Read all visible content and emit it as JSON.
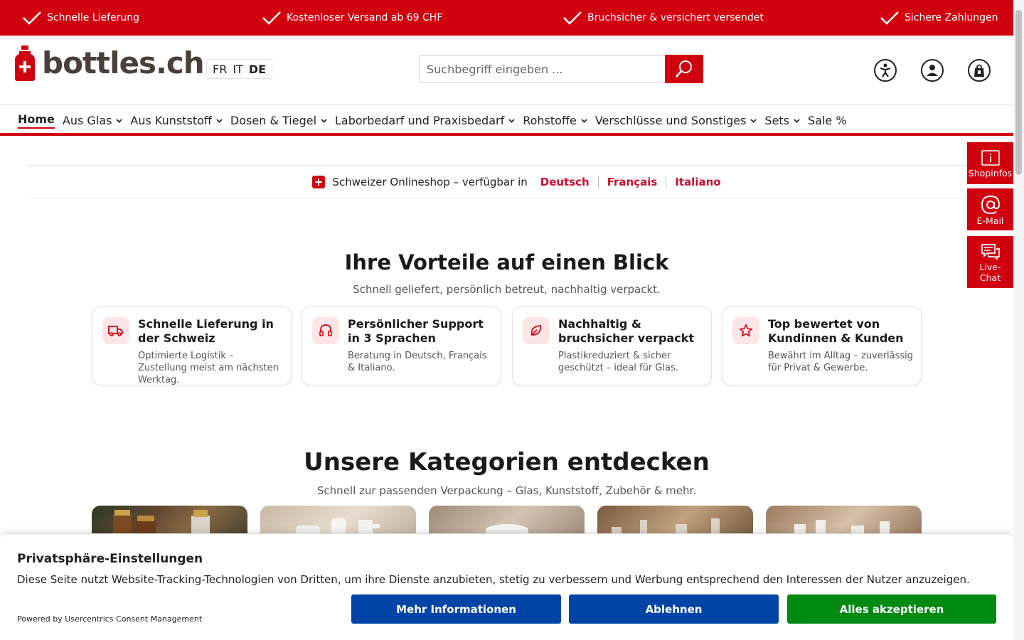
{
  "topbar": {
    "items": [
      "Schnelle Lieferung",
      "Kostenloser Versand ab 69 CHF",
      "Bruchsicher & versichert versendet",
      "Sichere Zahlungen"
    ]
  },
  "header": {
    "logo_text": "bottles.ch",
    "languages": [
      "FR",
      "IT",
      "DE"
    ],
    "active_language": "DE",
    "search_placeholder": "Suchbegriff eingeben ..."
  },
  "nav": {
    "items": [
      {
        "label": "Home",
        "dropdown": false,
        "active": true
      },
      {
        "label": "Aus Glas",
        "dropdown": true
      },
      {
        "label": "Aus Kunststoff",
        "dropdown": true
      },
      {
        "label": "Dosen & Tiegel",
        "dropdown": true
      },
      {
        "label": "Laborbedarf und Praxisbedarf",
        "dropdown": true
      },
      {
        "label": "Rohstoffe",
        "dropdown": true
      },
      {
        "label": "Verschlüsse und Sonstiges",
        "dropdown": true
      },
      {
        "label": "Sets",
        "dropdown": true
      },
      {
        "label": "Sale %",
        "dropdown": false
      }
    ]
  },
  "country_strip": {
    "text": "Schweizer Onlineshop – verfügbar in",
    "languages": [
      "Deutsch",
      "Français",
      "Italiano"
    ]
  },
  "benefits": {
    "title": "Ihre Vorteile auf einen Blick",
    "subtitle": "Schnell geliefert, persönlich betreut, nachhaltig verpackt.",
    "cards": [
      {
        "icon": "truck-icon",
        "title": "Schnelle Lieferung in der Schweiz",
        "text": "Optimierte Logistik – Zustellung meist am nächsten Werktag."
      },
      {
        "icon": "headset-icon",
        "title": "Persönlicher Support in 3 Sprachen",
        "text": "Beratung in Deutsch, Français & Italiano."
      },
      {
        "icon": "leaf-icon",
        "title": "Nachhaltig & bruchsicher verpackt",
        "text": "Plastikreduziert & sicher geschützt – ideal für Glas."
      },
      {
        "icon": "star-icon",
        "title": "Top bewertet von Kundinnen & Kunden",
        "text": "Bewährt im Alltag – zuverlässig für Privat & Gewerbe."
      }
    ]
  },
  "categories": {
    "title": "Unsere Kategorien entdecken",
    "subtitle": "Schnell zur passenden Verpackung – Glas, Kunststoff, Zubehör & mehr."
  },
  "side_buttons": [
    {
      "icon": "info-icon",
      "label": "Shopinfos"
    },
    {
      "icon": "at-icon",
      "label": "E-Mail"
    },
    {
      "icon": "chat-icon",
      "label": "Live-Chat"
    }
  ],
  "cookie": {
    "title": "Privatsphäre-Einstellungen",
    "text": "Diese Seite nutzt Website-Tracking-Technologien von Dritten, um ihre Dienste anzubieten, stetig zu verbessern und Werbung entsprechend den Interessen der Nutzer anzuzeigen.",
    "powered_by": "Powered by Usercentrics Consent Management",
    "more_info": "Mehr Informationen",
    "deny": "Ablehnen",
    "accept": "Alles akzeptieren"
  },
  "colors": {
    "brand_red": "#d1000f",
    "cookie_blue": "#0045a5",
    "cookie_green": "#008a12"
  }
}
